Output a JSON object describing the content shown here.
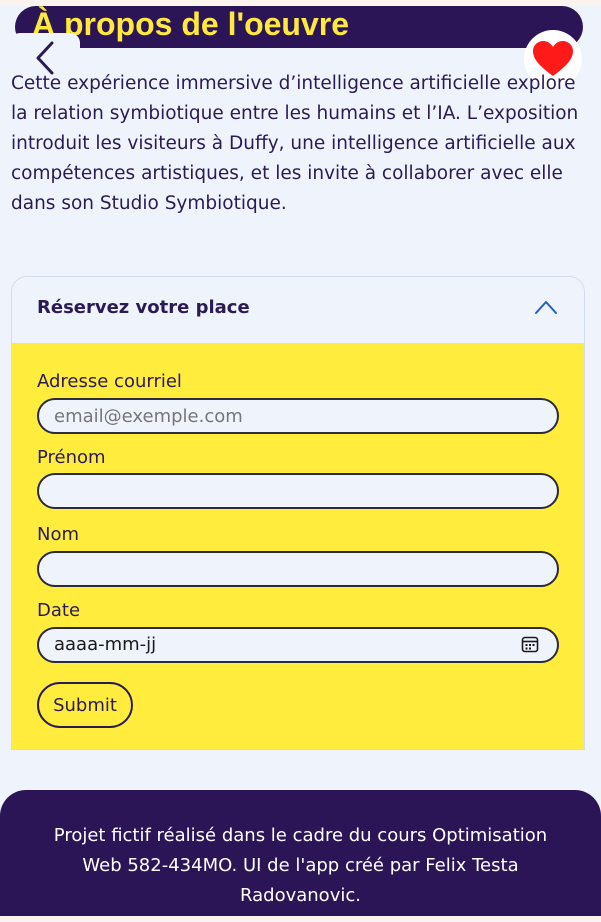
{
  "header": {
    "title": "À propos de l'oeuvre",
    "back_icon": "chevron-left-icon",
    "favorite_icon": "heart-icon"
  },
  "about": {
    "description": "Cette expérience immersive d’intelligence artificielle explore la relation symbiotique entre les humains et l’IA. L’exposition introduit les visiteurs à Duffy, une intelligence artificielle aux compétences artistiques, et les invite à collaborer avec elle dans son Studio Symbiotique."
  },
  "booking": {
    "title": "Réservez votre place",
    "expanded": true,
    "toggle_icon": "chevron-up-icon",
    "email": {
      "label": "Adresse courriel",
      "placeholder": "email@exemple.com",
      "value": ""
    },
    "firstname": {
      "label": "Prénom",
      "value": ""
    },
    "lastname": {
      "label": "Nom",
      "value": ""
    },
    "date": {
      "label": "Date",
      "value": "aaaa-mm-jj",
      "icon": "calendar-icon"
    },
    "submit_label": "Submit"
  },
  "footer": {
    "text": "Projet fictif réalisé dans le cadre du cours Optimisation Web 582-434MO. UI de l'app créé par Felix Testa Radovanovic."
  },
  "colors": {
    "background": "#eef3fc",
    "brand_purple": "#2b1557",
    "accent_yellow": "#ffec3d",
    "heart_red": "#ff1a1a"
  }
}
